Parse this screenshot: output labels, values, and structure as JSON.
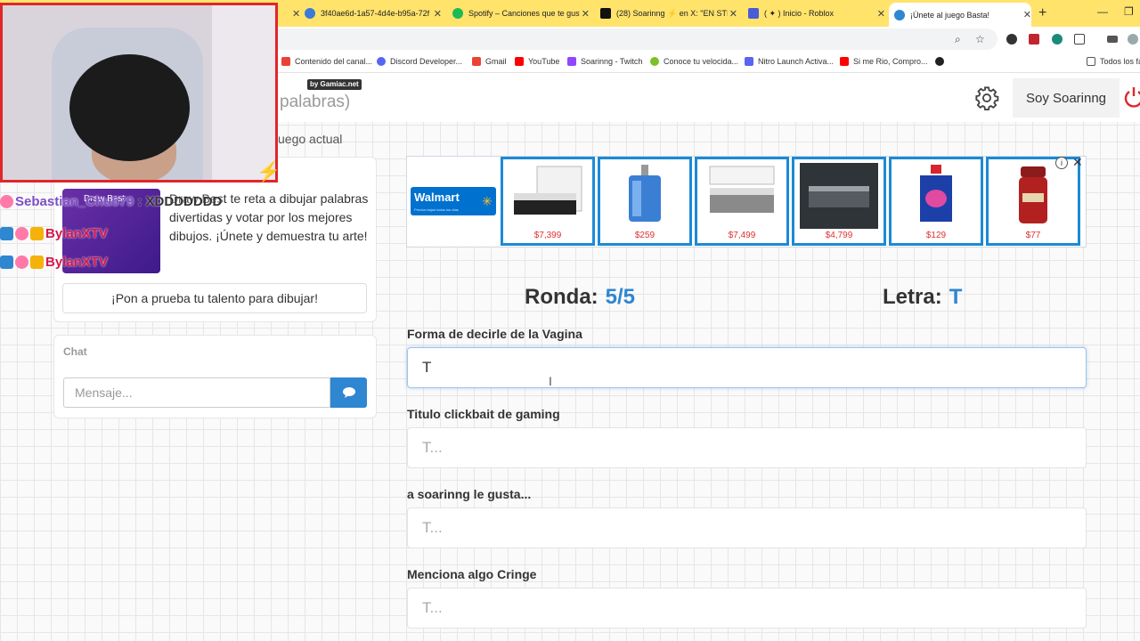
{
  "browser": {
    "tabs": [
      {
        "title": "3f40ae6d-1a57-4d4e-b95a-72f",
        "color": "#3a7bd5"
      },
      {
        "title": "Spotify – Canciones que te gust",
        "color": "#1db954"
      },
      {
        "title": "(28) Soarinng ⚡ en X: \"EN STI",
        "color": "#111111"
      },
      {
        "title": "( ✦ ) Inicio - Roblox",
        "color": "#4a5bd6"
      },
      {
        "title": "¡Únete al juego Basta!",
        "color": "#2f86d1"
      }
    ],
    "active_tab_index": 4,
    "bookmarks": [
      {
        "label": "Contenido del canal...",
        "color": "#ea4335"
      },
      {
        "label": "Discord Developer...",
        "color": "#5865f2"
      },
      {
        "label": "Gmail",
        "color": "#ea4335"
      },
      {
        "label": "YouTube",
        "color": "#ff0000"
      },
      {
        "label": "Soarinng - Twitch",
        "color": "#9146ff"
      },
      {
        "label": "Conoce tu velocida...",
        "color": "#7bbf2a"
      },
      {
        "label": "Nitro Launch Activa...",
        "color": "#5865f2"
      },
      {
        "label": "Si me Rio, Compro...",
        "color": "#ff0000"
      },
      {
        "label": "",
        "color": "#222222"
      }
    ],
    "all_bookmarks_label": "Todos los fa"
  },
  "header": {
    "title": "palabras)",
    "game_label": "uego actual",
    "username": "Soy Soarinng"
  },
  "game_card": {
    "logo_text": "Draw Best",
    "description": "Draw Best te reta a dibujar palabras divertidas y votar por los mejores dibujos. ¡Únete y demuestra tu arte!",
    "button_label": "¡Pon a prueba tu talento para dibujar!"
  },
  "chat": {
    "label": "Chat",
    "placeholder": "Mensaje..."
  },
  "ad": {
    "brand": "Walmart",
    "tagline": "Precios bajos todos los días",
    "products": [
      {
        "price": "$7,399",
        "kind": "bed-frame"
      },
      {
        "price": "$259",
        "kind": "perfume"
      },
      {
        "price": "$7,499",
        "kind": "bed-storage"
      },
      {
        "price": "$4,799",
        "kind": "bed-dark"
      },
      {
        "price": "$129",
        "kind": "detergent"
      },
      {
        "price": "$77",
        "kind": "deodorant"
      }
    ]
  },
  "game": {
    "round_label": "Ronda:",
    "round_value": "5/5",
    "letter_label": "Letra:",
    "letter_value": "T",
    "questions": [
      {
        "label": "Forma de decirle de la Vagina",
        "value": "T",
        "placeholder": "T..."
      },
      {
        "label": "Titulo clickbait de gaming",
        "value": "",
        "placeholder": "T..."
      },
      {
        "label": "a soarinng le gusta...",
        "value": "",
        "placeholder": "T..."
      },
      {
        "label": "Menciona algo Cringe",
        "value": "",
        "placeholder": "T..."
      }
    ]
  },
  "overlay": {
    "watermark": "by Gamiac.net",
    "chat_messages": [
      {
        "user": "Sebastian_Chu579",
        "message": ": XDDDDDDD"
      },
      {
        "user": "BylanXTV",
        "message": ""
      },
      {
        "user": "BylanXTV",
        "message": ""
      }
    ]
  }
}
